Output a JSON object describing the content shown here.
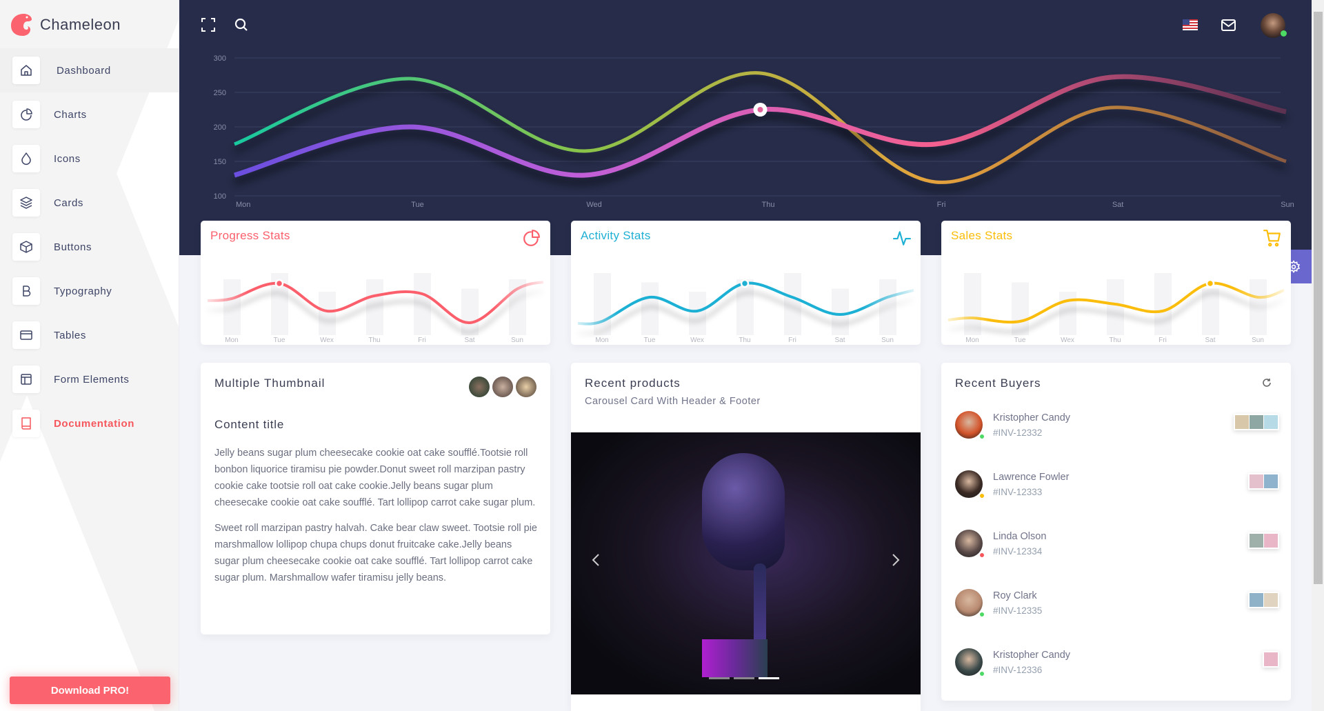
{
  "app": {
    "name": "Chameleon",
    "accent": "#fb646e"
  },
  "sidebar": {
    "items": [
      {
        "label": "Dashboard",
        "icon": "home-icon",
        "active": true
      },
      {
        "label": "Charts",
        "icon": "pie-chart-icon"
      },
      {
        "label": "Icons",
        "icon": "droplet-icon"
      },
      {
        "label": "Cards",
        "icon": "layers-icon"
      },
      {
        "label": "Buttons",
        "icon": "box-icon"
      },
      {
        "label": "Typography",
        "icon": "bold-icon"
      },
      {
        "label": "Tables",
        "icon": "credit-card-icon"
      },
      {
        "label": "Form Elements",
        "icon": "layout-icon"
      },
      {
        "label": "Documentation",
        "icon": "book-icon"
      }
    ],
    "download_label": "Download PRO!"
  },
  "header": {
    "icons": [
      "fullscreen-icon",
      "search-icon",
      "us-flag-icon",
      "mail-icon",
      "user-avatar"
    ]
  },
  "chart_data": [
    {
      "type": "line",
      "title": "",
      "categories": [
        "Mon",
        "Tue",
        "Wed",
        "Thu",
        "Fri",
        "Sat",
        "Sun"
      ],
      "yticks": [
        300,
        250,
        200,
        150,
        100
      ],
      "ylim": [
        100,
        300
      ],
      "grid": true,
      "series": [
        {
          "values": [
            175,
            270,
            165,
            278,
            120,
            228,
            150
          ],
          "colors": [
            "#19c9a0",
            "#8bc34a",
            "#e6a23c",
            "#8a5a40"
          ]
        },
        {
          "values": [
            130,
            200,
            130,
            225,
            175,
            272,
            222
          ],
          "colors": [
            "#6a4fe0",
            "#c15ed8",
            "#f4608f",
            "#5a3050"
          ],
          "highlight": "Thu"
        }
      ]
    },
    {
      "type": "bar+line",
      "title": "Progress Stats",
      "color": "#fb5f6c",
      "icon": "pie-chart-icon",
      "categories": [
        "Mon",
        "Tue",
        "Wex",
        "Thu",
        "Fri",
        "Sat",
        "Sun"
      ],
      "bars": [
        90,
        100,
        70,
        90,
        100,
        75,
        90
      ],
      "line": [
        53,
        75,
        35,
        57,
        60,
        18,
        67
      ],
      "highlight": "Tue"
    },
    {
      "type": "bar+line",
      "title": "Activity Stats",
      "color": "#1fb0d4",
      "icon": "activity-icon",
      "categories": [
        "Mon",
        "Tue",
        "Wex",
        "Thu",
        "Fri",
        "Sat",
        "Sun"
      ],
      "bars": [
        100,
        85,
        70,
        90,
        100,
        75,
        90
      ],
      "line": [
        20,
        55,
        35,
        75,
        55,
        30,
        55
      ],
      "highlight": "Thu"
    },
    {
      "type": "bar+line",
      "title": "Sales Stats",
      "color": "#fbbd08",
      "icon": "cart-icon",
      "categories": [
        "Mon",
        "Tue",
        "Wex",
        "Thu",
        "Fri",
        "Sat",
        "Sun"
      ],
      "bars": [
        100,
        85,
        70,
        90,
        100,
        75,
        90
      ],
      "line": [
        25,
        20,
        50,
        45,
        35,
        75,
        55
      ],
      "highlight": "Sat"
    }
  ],
  "thumbnail_card": {
    "title": "Multiple Thumbnail",
    "content_title": "Content title",
    "paragraphs": [
      "Jelly beans sugar plum cheesecake cookie oat cake soufflé.Tootsie roll bonbon liquorice tiramisu pie powder.Donut sweet roll marzipan pastry cookie cake tootsie roll oat cake cookie.Jelly beans sugar plum cheesecake cookie oat cake soufflé. Tart lollipop carrot cake sugar plum.",
      "Sweet roll marzipan pastry halvah. Cake bear claw sweet. Tootsie roll pie marshmallow lollipop chupa chups donut fruitcake cake.Jelly beans sugar plum cheesecake cookie oat cake soufflé. Tart lollipop carrot cake sugar plum. Marshmallow wafer tiramisu jelly beans."
    ]
  },
  "products_card": {
    "title": "Recent products",
    "subtitle": "Carousel Card With Header & Footer",
    "slides": 3,
    "active_slide": 3
  },
  "buyers_card": {
    "title": "Recent Buyers",
    "buyers": [
      {
        "name": "Kristopher Candy",
        "invoice": "#INV-12332",
        "status": "#4cd964",
        "avatar": "#d2532a",
        "thumbs": [
          "#d8c7a8",
          "#8fa7a3",
          "#b7dbe6"
        ]
      },
      {
        "name": "Lawrence Fowler",
        "invoice": "#INV-12333",
        "status": "#fbbd08",
        "avatar": "#3a2a24",
        "thumbs": [
          "#e4bfcc",
          "#8fb3cc"
        ]
      },
      {
        "name": "Linda Olson",
        "invoice": "#INV-12334",
        "status": "#f5575d",
        "avatar": "#5a4a48",
        "thumbs": [
          "#9fb0aa",
          "#e8b6c6"
        ]
      },
      {
        "name": "Roy Clark",
        "invoice": "#INV-12335",
        "status": "#4cd964",
        "avatar": "#b88a70",
        "thumbs": [
          "#8fb2c8",
          "#e0d4c0"
        ]
      },
      {
        "name": "Kristopher Candy",
        "invoice": "#INV-12336",
        "status": "#4cd964",
        "avatar": "#3b4a4a",
        "thumbs": [
          "#e8b6c6"
        ]
      }
    ]
  }
}
